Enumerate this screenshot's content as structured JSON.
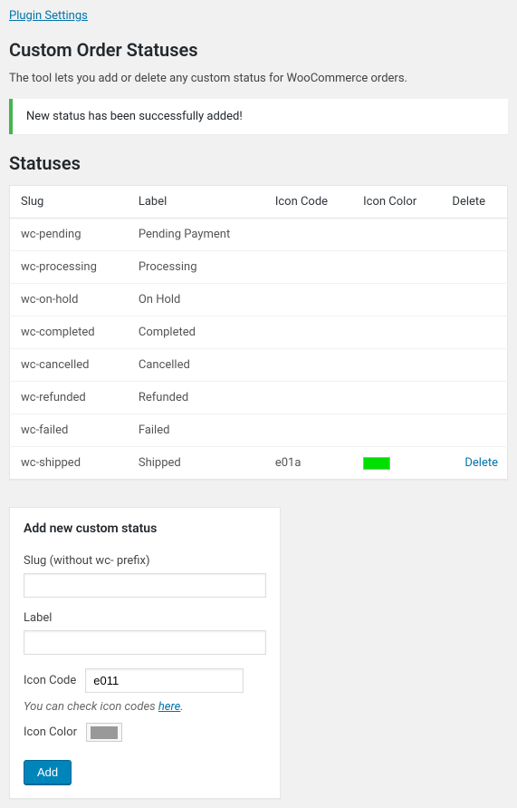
{
  "pluginLink": "Plugin Settings",
  "pageTitle": "Custom Order Statuses",
  "description": "The tool lets you add or delete any custom status for WooCommerce orders.",
  "notice": "New status has been successfully added!",
  "sectionTitle": "Statuses",
  "table": {
    "headers": {
      "slug": "Slug",
      "label": "Label",
      "iconCode": "Icon Code",
      "iconColor": "Icon Color",
      "delete": "Delete"
    },
    "rows": [
      {
        "slug": "wc-pending",
        "label": "Pending Payment",
        "iconCode": "",
        "iconColor": "",
        "deletable": false
      },
      {
        "slug": "wc-processing",
        "label": "Processing",
        "iconCode": "",
        "iconColor": "",
        "deletable": false
      },
      {
        "slug": "wc-on-hold",
        "label": "On Hold",
        "iconCode": "",
        "iconColor": "",
        "deletable": false
      },
      {
        "slug": "wc-completed",
        "label": "Completed",
        "iconCode": "",
        "iconColor": "",
        "deletable": false
      },
      {
        "slug": "wc-cancelled",
        "label": "Cancelled",
        "iconCode": "",
        "iconColor": "",
        "deletable": false
      },
      {
        "slug": "wc-refunded",
        "label": "Refunded",
        "iconCode": "",
        "iconColor": "",
        "deletable": false
      },
      {
        "slug": "wc-failed",
        "label": "Failed",
        "iconCode": "",
        "iconColor": "",
        "deletable": false
      },
      {
        "slug": "wc-shipped",
        "label": "Shipped",
        "iconCode": "e01a",
        "iconColor": "#00e000",
        "deletable": true
      }
    ],
    "deleteLabel": "Delete"
  },
  "form": {
    "title": "Add new custom status",
    "slugLabel": "Slug (without wc- prefix)",
    "slugValue": "",
    "labelLabel": "Label",
    "labelValue": "",
    "iconCodeLabel": "Icon Code",
    "iconCodeValue": "e011",
    "hintPrefix": "You can check icon codes ",
    "hintLink": "here",
    "hintSuffix": ".",
    "iconColorLabel": "Icon Color",
    "iconColorValue": "#999999",
    "addButton": "Add"
  }
}
